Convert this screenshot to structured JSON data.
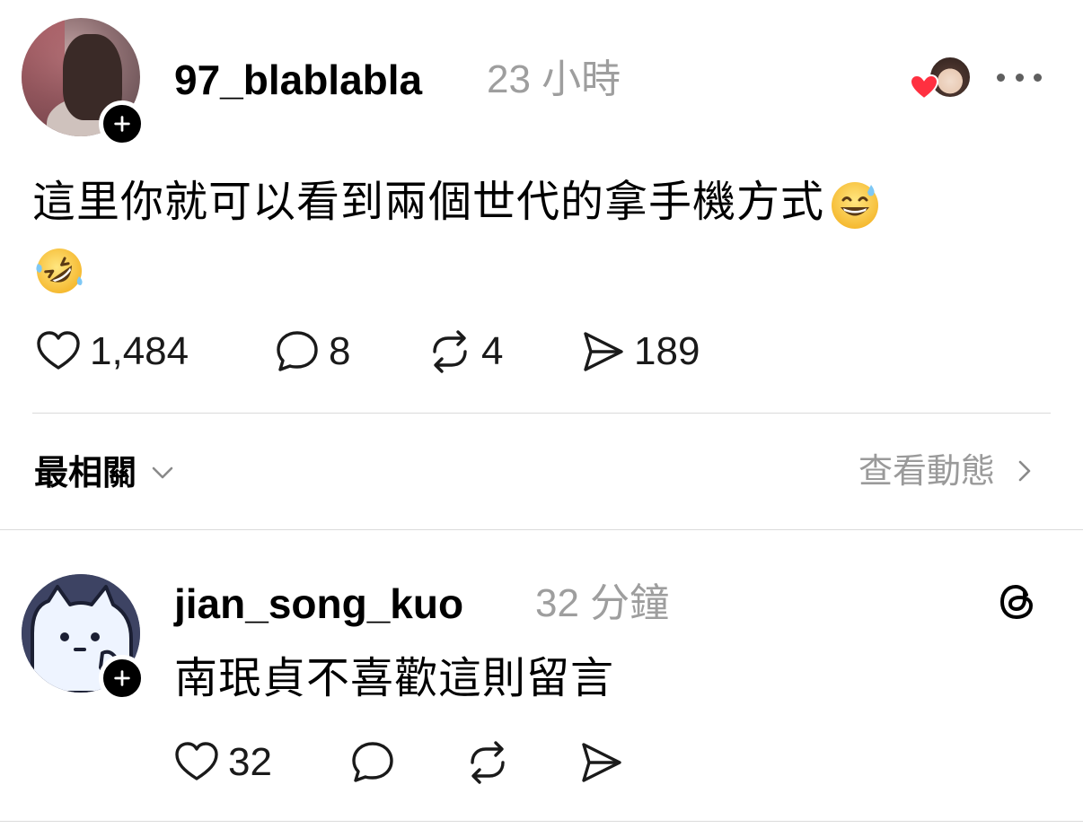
{
  "post": {
    "username": "97_blablabla",
    "timestamp": "23 小時",
    "text": "這里你就可以看到兩個世代的拿手機方式",
    "emojis": [
      "sweat-smile-emoji",
      "rolling-on-floor-laughing-emoji"
    ],
    "likes": "1,484",
    "replies": "8",
    "reposts": "4",
    "shares": "189"
  },
  "filter": {
    "sort_label": "最相關",
    "view_activity_label": "查看動態"
  },
  "comment": {
    "username": "jian_song_kuo",
    "timestamp": "32 分鐘",
    "text": "南珉貞不喜歡這則留言",
    "likes": "32"
  },
  "colors": {
    "text": "#000000",
    "muted": "#9e9e9e",
    "divider": "#dbdbdb",
    "heart": "#ff3040"
  },
  "icons": {
    "like": "heart-outline-icon",
    "reply": "speech-bubble-icon",
    "repost": "repost-icon",
    "share": "send-icon",
    "more": "more-horizontal-icon",
    "threads": "threads-logo-icon"
  }
}
